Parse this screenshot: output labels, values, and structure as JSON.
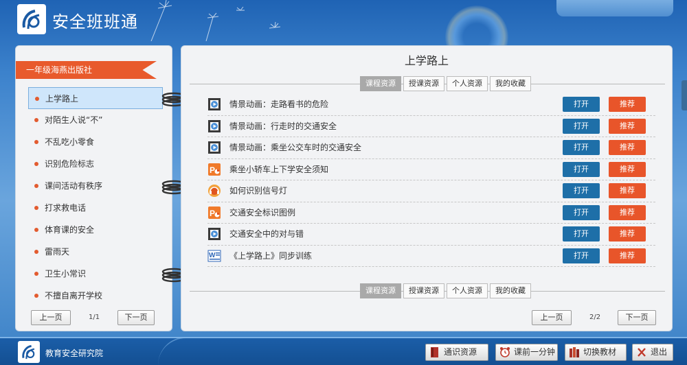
{
  "app": {
    "title": "安全班班通"
  },
  "sidebar": {
    "publisher": "一年级海燕出版社",
    "items": [
      {
        "label": "上学路上",
        "active": true
      },
      {
        "label": "对陌生人说“不”",
        "active": false
      },
      {
        "label": "不乱吃小零食",
        "active": false
      },
      {
        "label": "识别危险标志",
        "active": false
      },
      {
        "label": "课间活动有秩序",
        "active": false
      },
      {
        "label": "打求救电话",
        "active": false
      },
      {
        "label": "体育课的安全",
        "active": false
      },
      {
        "label": "雷雨天",
        "active": false
      },
      {
        "label": "卫生小常识",
        "active": false
      },
      {
        "label": "不擅自离开学校",
        "active": false
      }
    ],
    "prev_label": "上一页",
    "next_label": "下一页",
    "page_indicator": "1/1"
  },
  "main": {
    "title": "上学路上",
    "tabs": [
      {
        "label": "课程资源",
        "active": true
      },
      {
        "label": "授课资源",
        "active": false
      },
      {
        "label": "个人资源",
        "active": false
      },
      {
        "label": "我的收藏",
        "active": false
      }
    ],
    "open_label": "打开",
    "recommend_label": "推荐",
    "resources": [
      {
        "icon": "video-icon",
        "name": "情景动画：走路看书的危险"
      },
      {
        "icon": "video-icon",
        "name": "情景动画：行走时的交通安全"
      },
      {
        "icon": "video-icon",
        "name": "情景动画：乘坐公交车时的交通安全"
      },
      {
        "icon": "ppt-icon",
        "name": "乘坐小轿车上下学安全须知"
      },
      {
        "icon": "audio-icon",
        "name": "如何识别信号灯"
      },
      {
        "icon": "ppt-icon",
        "name": "交通安全标识图例"
      },
      {
        "icon": "video-icon",
        "name": "交通安全中的对与错"
      },
      {
        "icon": "word-icon",
        "name": "《上学路上》同步训练"
      }
    ],
    "prev_label": "上一页",
    "next_label": "下一页",
    "page_indicator": "2/2"
  },
  "footer": {
    "org": "教育安全研究院",
    "buttons": [
      {
        "label": "通识资源",
        "icon": "book-icon"
      },
      {
        "label": "课前一分钟",
        "icon": "alarm-clock-icon"
      },
      {
        "label": "切换教材",
        "icon": "books-icon"
      },
      {
        "label": "退出",
        "icon": "close-icon"
      }
    ]
  },
  "colors": {
    "accent_orange": "#e85a2c",
    "open_blue": "#1e6fa8",
    "header_blue": "#1f63b4"
  }
}
